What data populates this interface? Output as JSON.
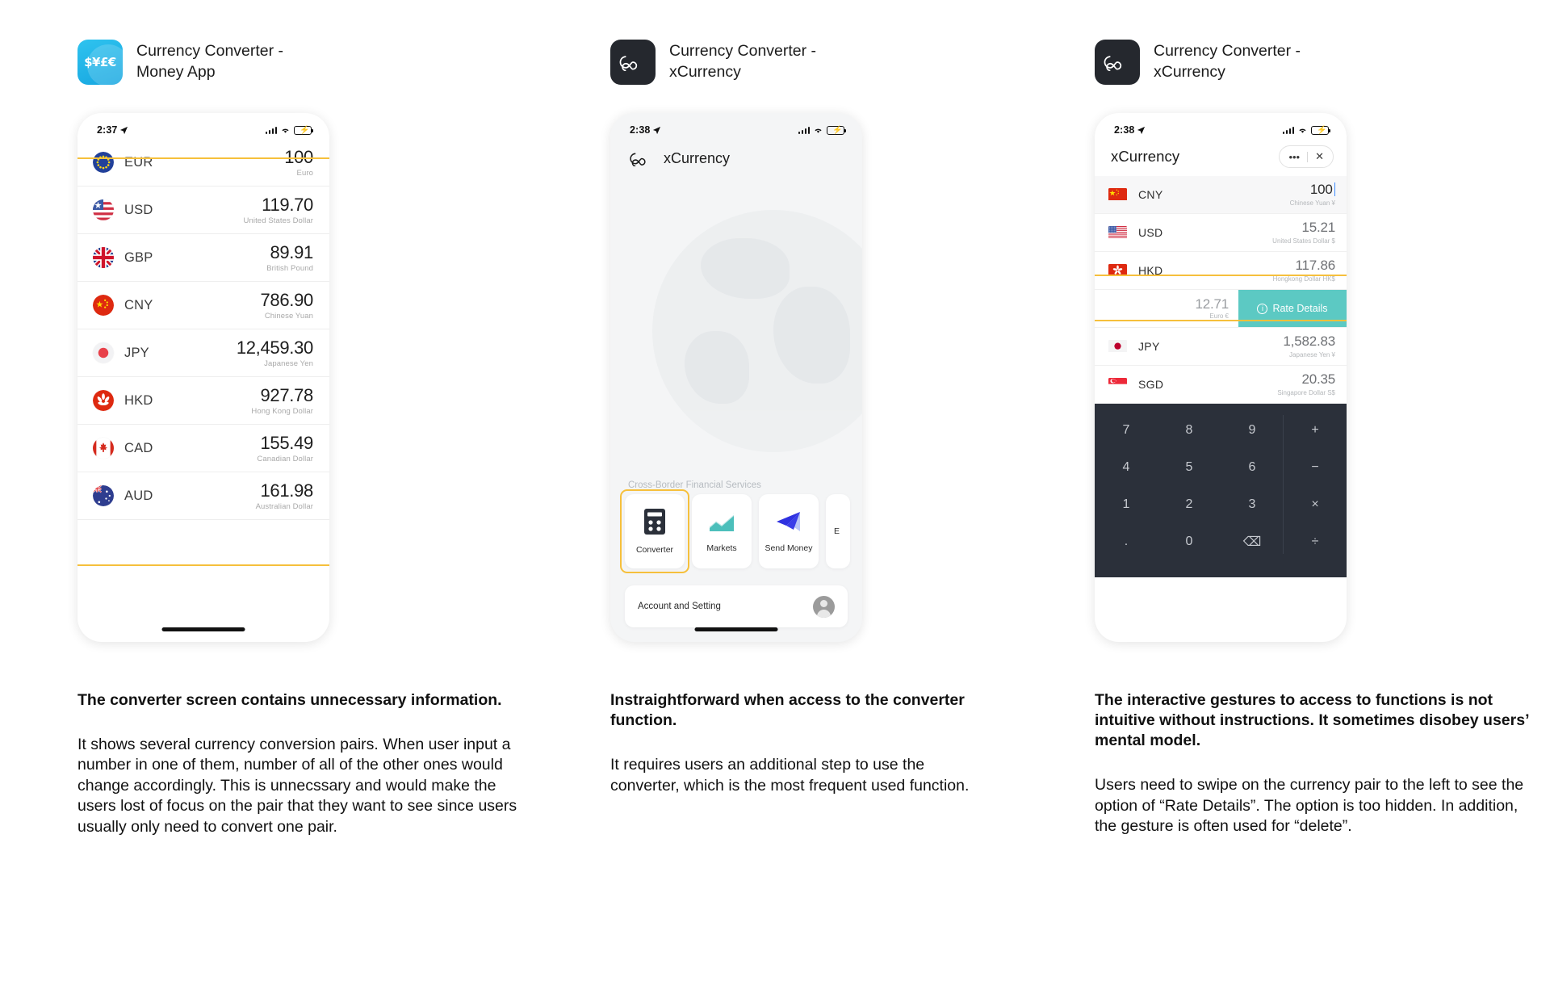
{
  "columns": [
    {
      "app": {
        "name": "Currency Converter -\nMoney App",
        "icon": "currency-symbols-globe-icon",
        "icon_text": "$¥£€"
      },
      "phone": {
        "status": {
          "time": "2:37",
          "location_icon": "location-arrow-icon",
          "signal_icon": "cellular-bars-icon",
          "wifi_icon": "wifi-icon",
          "battery_icon": "battery-charging-icon"
        },
        "rows": [
          {
            "flag": "eu-flag",
            "code": "EUR",
            "amount": "100",
            "name": "Euro"
          },
          {
            "flag": "us-flag",
            "code": "USD",
            "amount": "119.70",
            "name": "United States Dollar"
          },
          {
            "flag": "gb-flag",
            "code": "GBP",
            "amount": "89.91",
            "name": "British Pound"
          },
          {
            "flag": "cn-flag",
            "code": "CNY",
            "amount": "786.90",
            "name": "Chinese Yuan"
          },
          {
            "flag": "jp-flag",
            "code": "JPY",
            "amount": "12,459.30",
            "name": "Japanese Yen"
          },
          {
            "flag": "hk-flag",
            "code": "HKD",
            "amount": "927.78",
            "name": "Hong Kong Dollar"
          },
          {
            "flag": "ca-flag",
            "code": "CAD",
            "amount": "155.49",
            "name": "Canadian Dollar"
          },
          {
            "flag": "au-flag",
            "code": "AUD",
            "amount": "161.98",
            "name": "Australian Dollar"
          }
        ]
      },
      "caption": {
        "title": "The converter screen contains unnecessary information.",
        "body": "It shows several currency conversion pairs. When user input a number in one of them, number of all of the other ones would change accordingly. This is unnecssary and would make the users lost of focus on the pair that they want to see since users usually only need to convert one pair."
      }
    },
    {
      "app": {
        "name": "Currency Converter -\nxCurrency",
        "icon": "infinity-icon"
      },
      "phone": {
        "status": {
          "time": "2:38",
          "location_icon": "location-arrow-icon",
          "signal_icon": "cellular-bars-icon",
          "wifi_icon": "wifi-icon",
          "battery_icon": "battery-charging-icon"
        },
        "brand": "xCurrency",
        "services_label": "Cross-Border Financial Services",
        "services": [
          {
            "label": "Converter",
            "icon": "calculator-icon"
          },
          {
            "label": "Markets",
            "icon": "chart-line-icon"
          },
          {
            "label": "Send Money",
            "icon": "paper-plane-icon"
          },
          {
            "label": "E",
            "icon": "partial-icon"
          }
        ],
        "account_label": "Account and Setting",
        "account_icon": "user-avatar-icon"
      },
      "caption": {
        "title": "Instraightforward when access to the converter function.",
        "body": "It requires users an additional step to use the converter, which is the most frequent used function."
      }
    },
    {
      "app": {
        "name": "Currency Converter -\nxCurrency",
        "icon": "infinity-icon"
      },
      "phone": {
        "status": {
          "time": "2:38",
          "location_icon": "location-arrow-icon",
          "signal_icon": "cellular-bars-icon",
          "wifi_icon": "wifi-icon",
          "battery_icon": "battery-charging-icon"
        },
        "title": "xCurrency",
        "controls": {
          "more": "•••",
          "close": "✕"
        },
        "rows": [
          {
            "flag": "cn-flag",
            "code": "CNY",
            "amount": "100",
            "name": "Chinese Yuan ¥",
            "active": true
          },
          {
            "flag": "us-flag",
            "code": "USD",
            "amount": "15.21",
            "name": "United States Dollar $",
            "active": false
          },
          {
            "flag": "hk-flag",
            "code": "HKD",
            "amount": "117.86",
            "name": "Hongkong Dollar HK$",
            "active": false
          }
        ],
        "swipe_row": {
          "amount": "12.71",
          "name": "Euro €",
          "action_label": "Rate Details",
          "action_icon": "info-circle-icon"
        },
        "rows_after": [
          {
            "flag": "jp-flag",
            "code": "JPY",
            "amount": "1,582.83",
            "name": "Japanese Yen ¥"
          },
          {
            "flag": "sg-flag",
            "code": "SGD",
            "amount": "20.35",
            "name": "Singapore Dollar S$"
          }
        ],
        "keypad": [
          "7",
          "8",
          "9",
          "+",
          "4",
          "5",
          "6",
          "−",
          "1",
          "2",
          "3",
          "×",
          ".",
          "0",
          "⌫",
          "÷"
        ]
      },
      "caption": {
        "title": "The interactive gestures to access to functions is not intuitive without instructions. It sometimes disobey users’ mental model.",
        "body": "Users need to swipe on the currency pair to the left to see the option of “Rate Details”. The option is too hidden. In addition, the gesture is often used for “delete”."
      }
    }
  ],
  "colors": {
    "highlight": "#f6c03c",
    "accent_teal": "#5cc9c3",
    "keypad_bg": "#2b303a",
    "brand_dark": "#25282e"
  }
}
